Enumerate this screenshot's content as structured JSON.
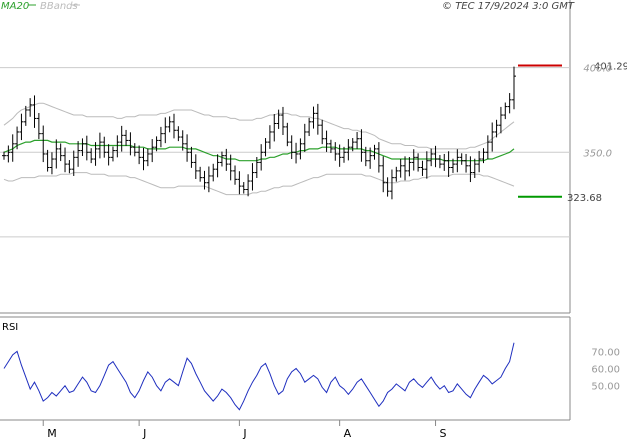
{
  "header": {
    "legend_ma": "MA20",
    "legend_bb": "BBands",
    "timestamp": "© TEC 17/9/2024 3:0 GMT"
  },
  "colors": {
    "price": "#000000",
    "ma": "#2ca02c",
    "bands": "#bbbbbb",
    "high_marker": "#cc0000",
    "low_marker": "#009900",
    "rsi": "#1f2fbf",
    "grid": "#cccccc"
  },
  "chart_data": [
    {
      "type": "ohlc",
      "ylim": [
        255,
        440
      ],
      "y_ticks": [
        {
          "value": 350,
          "label": "350.0"
        },
        {
          "value": 400,
          "label": "400.0"
        }
      ],
      "markers": {
        "high": {
          "value": 401.29,
          "label": "401.29"
        },
        "low": {
          "value": 323.68,
          "label": "323.68"
        }
      },
      "close": [
        348,
        350,
        355,
        362,
        368,
        375,
        378,
        370,
        361,
        349,
        341,
        346,
        352,
        348,
        343,
        340,
        347,
        351,
        355,
        350,
        346,
        352,
        356,
        350,
        347,
        351,
        356,
        360,
        357,
        353,
        350,
        347,
        345,
        349,
        353,
        357,
        361,
        365,
        368,
        363,
        359,
        355,
        350,
        344,
        339,
        335,
        332,
        336,
        340,
        344,
        348,
        343,
        339,
        334,
        330,
        328,
        333,
        338,
        344,
        350,
        356,
        362,
        367,
        372,
        365,
        356,
        350,
        349,
        355,
        362,
        368,
        373,
        366,
        358,
        355,
        352,
        349,
        347,
        350,
        353,
        356,
        358,
        350,
        345,
        348,
        352,
        342,
        332,
        327,
        335,
        339,
        342,
        339,
        344,
        347,
        341,
        340,
        345,
        349,
        346,
        343,
        345,
        341,
        343,
        347,
        345,
        342,
        338,
        343,
        346,
        350,
        356,
        362,
        366,
        372,
        377,
        381,
        395
      ],
      "ma20": [
        350,
        351,
        352,
        354,
        355,
        356,
        356,
        357,
        357,
        357,
        357,
        356,
        356,
        356,
        356,
        355,
        355,
        355,
        355,
        355,
        354,
        354,
        354,
        354,
        354,
        354,
        354,
        354,
        354,
        354,
        353,
        353,
        353,
        352,
        352,
        352,
        352,
        352,
        353,
        353,
        353,
        353,
        352,
        352,
        352,
        351,
        350,
        349,
        348,
        348,
        347,
        346,
        346,
        346,
        345,
        345,
        345,
        345,
        345,
        346,
        346,
        347,
        347,
        348,
        349,
        349,
        350,
        350,
        351,
        351,
        352,
        352,
        352,
        353,
        353,
        353,
        353,
        352,
        352,
        352,
        352,
        352,
        352,
        351,
        351,
        350,
        349,
        348,
        347,
        346,
        346,
        346,
        346,
        346,
        346,
        346,
        346,
        346,
        346,
        346,
        346,
        345,
        345,
        345,
        345,
        345,
        345,
        345,
        345,
        345,
        345,
        346,
        346,
        347,
        348,
        349,
        350,
        352
      ],
      "bb_upper": [
        366,
        368,
        370,
        373,
        375,
        376,
        377,
        378,
        379,
        379,
        378,
        377,
        376,
        375,
        374,
        373,
        372,
        372,
        372,
        371,
        371,
        371,
        371,
        371,
        371,
        371,
        370,
        370,
        371,
        371,
        371,
        372,
        372,
        372,
        372,
        372,
        373,
        373,
        374,
        375,
        375,
        375,
        375,
        375,
        374,
        373,
        372,
        372,
        371,
        371,
        371,
        371,
        370,
        370,
        369,
        369,
        369,
        369,
        370,
        370,
        371,
        372,
        372,
        373,
        373,
        373,
        372,
        372,
        371,
        371,
        371,
        370,
        370,
        369,
        368,
        367,
        366,
        365,
        364,
        364,
        363,
        363,
        362,
        362,
        361,
        360,
        358,
        357,
        356,
        355,
        355,
        355,
        354,
        354,
        354,
        353,
        353,
        353,
        352,
        352,
        352,
        352,
        352,
        352,
        352,
        352,
        352,
        353,
        353,
        354,
        355,
        356,
        358,
        360,
        362,
        364,
        366,
        368
      ],
      "bb_lower": [
        334,
        333,
        333,
        334,
        335,
        335,
        335,
        335,
        336,
        336,
        336,
        336,
        336,
        337,
        337,
        337,
        338,
        338,
        338,
        338,
        337,
        337,
        337,
        337,
        336,
        336,
        336,
        336,
        336,
        335,
        335,
        334,
        333,
        332,
        331,
        330,
        329,
        329,
        329,
        329,
        330,
        330,
        330,
        330,
        330,
        330,
        330,
        329,
        328,
        327,
        326,
        325,
        325,
        325,
        325,
        325,
        325,
        326,
        326,
        327,
        327,
        328,
        329,
        329,
        330,
        330,
        330,
        331,
        332,
        333,
        334,
        335,
        335,
        336,
        337,
        337,
        337,
        337,
        337,
        337,
        337,
        337,
        337,
        336,
        336,
        335,
        334,
        333,
        332,
        332,
        332,
        333,
        333,
        333,
        334,
        334,
        335,
        335,
        336,
        336,
        336,
        336,
        336,
        337,
        337,
        337,
        337,
        337,
        337,
        337,
        336,
        336,
        335,
        334,
        333,
        332,
        331,
        330
      ]
    },
    {
      "type": "line",
      "title": "RSI",
      "ylim": [
        30,
        90
      ],
      "y_ticks": [
        {
          "value": 50,
          "label": "50.00"
        },
        {
          "value": 60,
          "label": "60.00"
        },
        {
          "value": 70,
          "label": "70.00"
        }
      ],
      "values": [
        60,
        64,
        68,
        70,
        62,
        55,
        48,
        52,
        47,
        41,
        43,
        46,
        44,
        47,
        50,
        46,
        47,
        51,
        55,
        52,
        47,
        46,
        50,
        56,
        62,
        64,
        60,
        56,
        52,
        46,
        43,
        47,
        53,
        58,
        55,
        50,
        47,
        52,
        54,
        52,
        50,
        58,
        66,
        63,
        57,
        52,
        47,
        44,
        41,
        44,
        48,
        46,
        43,
        39,
        36,
        41,
        47,
        52,
        56,
        61,
        63,
        57,
        50,
        45,
        47,
        54,
        58,
        60,
        57,
        52,
        54,
        56,
        54,
        49,
        46,
        52,
        55,
        50,
        48,
        45,
        48,
        52,
        54,
        50,
        46,
        42,
        38,
        41,
        46,
        48,
        51,
        49,
        47,
        52,
        54,
        51,
        49,
        52,
        55,
        51,
        48,
        50,
        46,
        47,
        51,
        48,
        45,
        43,
        48,
        52,
        56,
        54,
        51,
        53,
        55,
        60,
        64,
        75
      ]
    }
  ],
  "x_axis": {
    "labels": [
      {
        "label": "M",
        "index": 9
      },
      {
        "label": "J",
        "index": 31
      },
      {
        "label": "J",
        "index": 54
      },
      {
        "label": "A",
        "index": 77
      },
      {
        "label": "S",
        "index": 99
      }
    ]
  }
}
